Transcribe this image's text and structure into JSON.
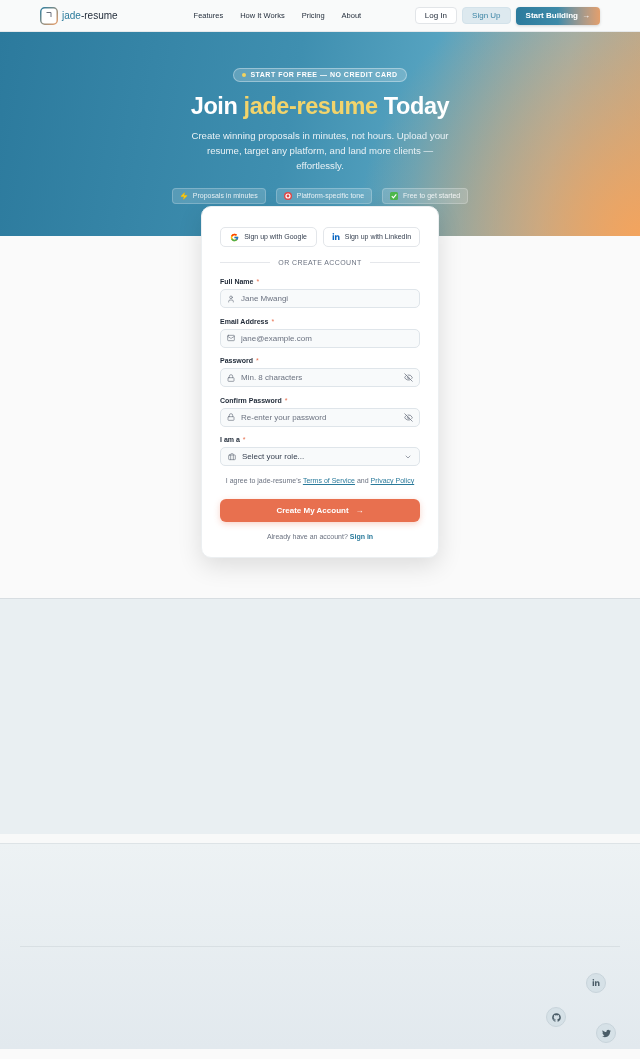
{
  "nav": {
    "brand": {
      "primary": "jade",
      "secondary": "-resume"
    },
    "links": [
      {
        "label": "Features"
      },
      {
        "label": "How It Works"
      },
      {
        "label": "Pricing"
      },
      {
        "label": "About"
      }
    ],
    "buttons": [
      {
        "kind": "outline",
        "label": "Log In"
      },
      {
        "kind": "soft",
        "label": "Sign Up"
      },
      {
        "kind": "gradient",
        "label": "Start Building",
        "arrow": "→"
      }
    ]
  },
  "hero": {
    "badge": "START FOR FREE — NO CREDIT CARD",
    "title": {
      "before": "Join",
      "highlight": "jade-resume",
      "after": "Today"
    },
    "subtitle": "Create winning proposals in minutes, not hours. Upload your resume, target any platform, and land more clients — effortlessly.",
    "features": [
      {
        "label": "Proposals in minutes"
      },
      {
        "label": "Platform-specific tone"
      },
      {
        "label": "Free to get started"
      }
    ]
  },
  "signup": {
    "social": [
      {
        "kind": "google",
        "label": "Sign up with Google"
      },
      {
        "kind": "linkedin",
        "label": "Sign up with LinkedIn"
      }
    ],
    "divider": "OR CREATE ACCOUNT",
    "fields": [
      {
        "kind": "text",
        "label": "Full Name",
        "required_mark": "*",
        "placeholder": "Jane Mwangi"
      },
      {
        "kind": "text",
        "label": "Email Address",
        "required_mark": "*",
        "placeholder": "jane@example.com"
      },
      {
        "kind": "password",
        "label": "Password",
        "required_mark": "*",
        "placeholder": "Min. 8 characters"
      },
      {
        "kind": "password",
        "label": "Confirm Password",
        "required_mark": "*",
        "placeholder": "Re-enter your password"
      },
      {
        "kind": "select",
        "label": "I am a",
        "required_mark": "*",
        "placeholder": "Select your role..."
      }
    ],
    "consent": {
      "before": "I agree to jade-resume's",
      "terms": "Terms of Service",
      "middle": "and",
      "privacy": "Privacy Policy"
    },
    "submit": {
      "label": "Create My Account",
      "arrow": "→"
    },
    "signin": {
      "prompt": "Already have an account?",
      "link": "Sign in"
    }
  }
}
